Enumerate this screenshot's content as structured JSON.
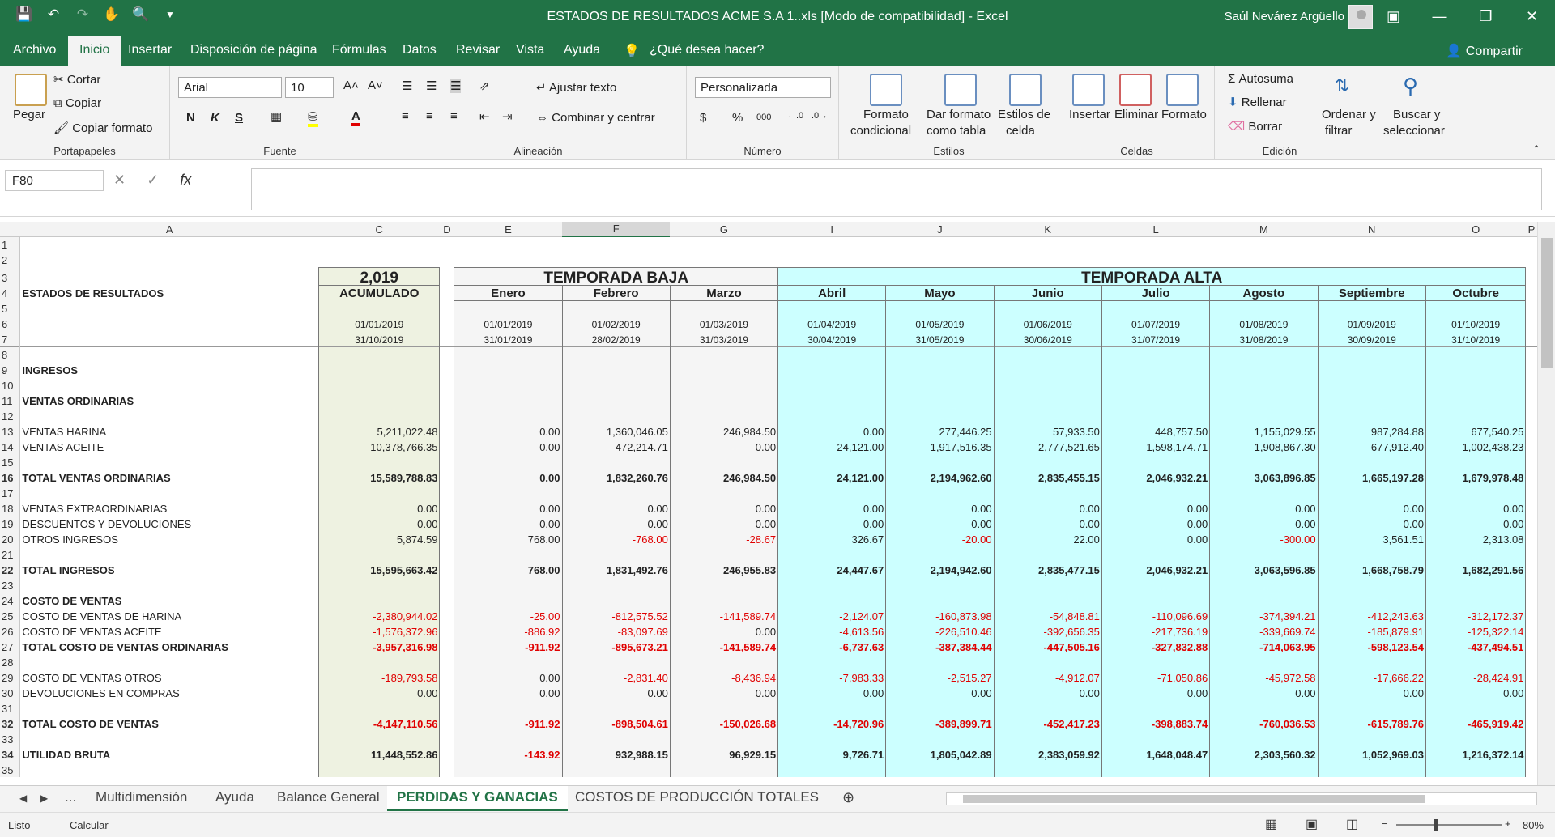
{
  "window": {
    "title": "ESTADOS DE RESULTADOS ACME S.A 1..xls  [Modo de compatibilidad]  -  Excel",
    "user": "Saúl Nevárez Argüello"
  },
  "menu": {
    "tabs": [
      "Archivo",
      "Inicio",
      "Insertar",
      "Disposición de página",
      "Fórmulas",
      "Datos",
      "Revisar",
      "Vista",
      "Ayuda"
    ],
    "tell": "¿Qué desea hacer?",
    "share": "Compartir"
  },
  "ribbon": {
    "clip": {
      "paste": "Pegar",
      "cut": "Cortar",
      "copy": "Copiar",
      "painter": "Copiar formato",
      "label": "Portapapeles"
    },
    "font": {
      "name": "Arial",
      "size": "10",
      "bold": "N",
      "italic": "K",
      "underline": "S",
      "label": "Fuente"
    },
    "align": {
      "wrap": "Ajustar texto",
      "merge": "Combinar y centrar",
      "label": "Alineación"
    },
    "number": {
      "format": "Personalizada",
      "currency": "$",
      "percent": "%",
      "thousands": "000",
      "label": "Número"
    },
    "styles": {
      "cond": "Formato",
      "cond2": "condicional",
      "table": "Dar formato",
      "table2": "como tabla",
      "cell": "Estilos de",
      "cell2": "celda",
      "label": "Estilos"
    },
    "cells": {
      "insert": "Insertar",
      "delete": "Eliminar",
      "format": "Formato",
      "label": "Celdas"
    },
    "edit": {
      "autosum": "Autosuma",
      "fill": "Rellenar",
      "clear": "Borrar",
      "sort": "Ordenar y",
      "sort2": "filtrar",
      "find": "Buscar y",
      "find2": "seleccionar",
      "label": "Edición"
    }
  },
  "formula": {
    "namebox": "F80",
    "value": ""
  },
  "grid": {
    "cols": [
      "A",
      "C",
      "D",
      "E",
      "F",
      "G",
      "I",
      "J",
      "K",
      "L",
      "M",
      "N",
      "O",
      "P"
    ],
    "year": "2,019",
    "low": "TEMPORADA BAJA",
    "high": "TEMPORADA ALTA",
    "title": "ESTADOS DE RESULTADOS",
    "acum": "ACUMULADO",
    "months": [
      "Enero",
      "Febrero",
      "Marzo",
      "Abril",
      "Mayo",
      "Junio",
      "Julio",
      "Agosto",
      "Septiembre",
      "Octubre"
    ],
    "start": [
      "01/01/2019",
      "01/01/2019",
      "01/02/2019",
      "01/03/2019",
      "01/04/2019",
      "01/05/2019",
      "01/06/2019",
      "01/07/2019",
      "01/08/2019",
      "01/09/2019",
      "01/10/2019"
    ],
    "end": [
      "31/10/2019",
      "31/01/2019",
      "28/02/2019",
      "31/03/2019",
      "30/04/2019",
      "31/05/2019",
      "30/06/2019",
      "31/07/2019",
      "31/08/2019",
      "30/09/2019",
      "31/10/2019"
    ],
    "rows": [
      {
        "r": "9",
        "label": "INGRESOS",
        "type": "sec"
      },
      {
        "r": "10",
        "type": "blank"
      },
      {
        "r": "11",
        "label": "VENTAS ORDINARIAS",
        "type": "sec"
      },
      {
        "r": "12",
        "type": "blank"
      },
      {
        "r": "13",
        "label": "VENTAS HARINA",
        "type": "n",
        "v": [
          "5,211,022.48",
          "0.00",
          "1,360,046.05",
          "246,984.50",
          "0.00",
          "277,446.25",
          "57,933.50",
          "448,757.50",
          "1,155,029.55",
          "987,284.88",
          "677,540.25"
        ]
      },
      {
        "r": "14",
        "label": "VENTAS ACEITE",
        "type": "n",
        "v": [
          "10,378,766.35",
          "0.00",
          "472,214.71",
          "0.00",
          "24,121.00",
          "1,917,516.35",
          "2,777,521.65",
          "1,598,174.71",
          "1,908,867.30",
          "677,912.40",
          "1,002,438.23"
        ]
      },
      {
        "r": "15",
        "type": "blank"
      },
      {
        "r": "16",
        "label": "TOTAL VENTAS ORDINARIAS",
        "type": "big",
        "v": [
          "15,589,788.83",
          "0.00",
          "1,832,260.76",
          "246,984.50",
          "24,121.00",
          "2,194,962.60",
          "2,835,455.15",
          "2,046,932.21",
          "3,063,896.85",
          "1,665,197.28",
          "1,679,978.48"
        ]
      },
      {
        "r": "17",
        "type": "blank"
      },
      {
        "r": "18",
        "label": "VENTAS EXTRAORDINARIAS",
        "type": "n",
        "v": [
          "0.00",
          "0.00",
          "0.00",
          "0.00",
          "0.00",
          "0.00",
          "0.00",
          "0.00",
          "0.00",
          "0.00",
          "0.00"
        ]
      },
      {
        "r": "19",
        "label": "DESCUENTOS Y DEVOLUCIONES",
        "type": "n",
        "v": [
          "0.00",
          "0.00",
          "0.00",
          "0.00",
          "0.00",
          "0.00",
          "0.00",
          "0.00",
          "0.00",
          "0.00",
          "0.00"
        ]
      },
      {
        "r": "20",
        "label": "OTROS INGRESOS",
        "type": "n",
        "v": [
          "5,874.59",
          "768.00",
          "-768.00",
          "-28.67",
          "326.67",
          "-20.00",
          "22.00",
          "0.00",
          "-300.00",
          "3,561.51",
          "2,313.08"
        ]
      },
      {
        "r": "21",
        "type": "blank"
      },
      {
        "r": "22",
        "label": "TOTAL INGRESOS",
        "type": "big",
        "v": [
          "15,595,663.42",
          "768.00",
          "1,831,492.76",
          "246,955.83",
          "24,447.67",
          "2,194,942.60",
          "2,835,477.15",
          "2,046,932.21",
          "3,063,596.85",
          "1,668,758.79",
          "1,682,291.56"
        ]
      },
      {
        "r": "23",
        "type": "blank"
      },
      {
        "r": "24",
        "label": "COSTO DE VENTAS",
        "type": "sec"
      },
      {
        "r": "25",
        "label": "COSTO DE VENTAS DE HARINA",
        "type": "n",
        "v": [
          "-2,380,944.02",
          "-25.00",
          "-812,575.52",
          "-141,589.74",
          "-2,124.07",
          "-160,873.98",
          "-54,848.81",
          "-110,096.69",
          "-374,394.21",
          "-412,243.63",
          "-312,172.37"
        ]
      },
      {
        "r": "26",
        "label": "COSTO DE VENTAS ACEITE",
        "type": "n",
        "v": [
          "-1,576,372.96",
          "-886.92",
          "-83,097.69",
          "0.00",
          "-4,613.56",
          "-226,510.46",
          "-392,656.35",
          "-217,736.19",
          "-339,669.74",
          "-185,879.91",
          "-125,322.14"
        ]
      },
      {
        "r": "27",
        "label": "TOTAL COSTO DE VENTAS ORDINARIAS",
        "type": "nb",
        "v": [
          "-3,957,316.98",
          "-911.92",
          "-895,673.21",
          "-141,589.74",
          "-6,737.63",
          "-387,384.44",
          "-447,505.16",
          "-327,832.88",
          "-714,063.95",
          "-598,123.54",
          "-437,494.51"
        ]
      },
      {
        "r": "28",
        "type": "blank"
      },
      {
        "r": "29",
        "label": "COSTO DE VENTAS OTROS",
        "type": "n",
        "v": [
          "-189,793.58",
          "0.00",
          "-2,831.40",
          "-8,436.94",
          "-7,983.33",
          "-2,515.27",
          "-4,912.07",
          "-71,050.86",
          "-45,972.58",
          "-17,666.22",
          "-28,424.91"
        ]
      },
      {
        "r": "30",
        "label": "DEVOLUCIONES EN COMPRAS",
        "type": "n",
        "v": [
          "0.00",
          "0.00",
          "0.00",
          "0.00",
          "0.00",
          "0.00",
          "0.00",
          "0.00",
          "0.00",
          "0.00",
          "0.00"
        ]
      },
      {
        "r": "31",
        "type": "blank"
      },
      {
        "r": "32",
        "label": "TOTAL COSTO DE VENTAS",
        "type": "big",
        "v": [
          "-4,147,110.56",
          "-911.92",
          "-898,504.61",
          "-150,026.68",
          "-14,720.96",
          "-389,899.71",
          "-452,417.23",
          "-398,883.74",
          "-760,036.53",
          "-615,789.76",
          "-465,919.42"
        ]
      },
      {
        "r": "33",
        "type": "blank"
      },
      {
        "r": "34",
        "label": "UTILIDAD BRUTA",
        "type": "big",
        "v": [
          "11,448,552.86",
          "-143.92",
          "932,988.15",
          "96,929.15",
          "9,726.71",
          "1,805,042.89",
          "2,383,059.92",
          "1,648,048.47",
          "2,303,560.32",
          "1,052,969.03",
          "1,216,372.14"
        ]
      },
      {
        "r": "35",
        "type": "blank"
      }
    ]
  },
  "sheets": {
    "tabs": [
      "Multidimensión",
      "Ayuda",
      "Balance General",
      "PERDIDAS Y GANACIAS",
      "COSTOS DE PRODUCCIÓN TOTALES"
    ],
    "ellipsis": "..."
  },
  "status": {
    "ready": "Listo",
    "calc": "Calcular",
    "zoom": "80%"
  },
  "colors": {
    "green": "#217346",
    "cyan": "#ccffff",
    "beige": "#eef2e1",
    "negative": "#e00000"
  }
}
